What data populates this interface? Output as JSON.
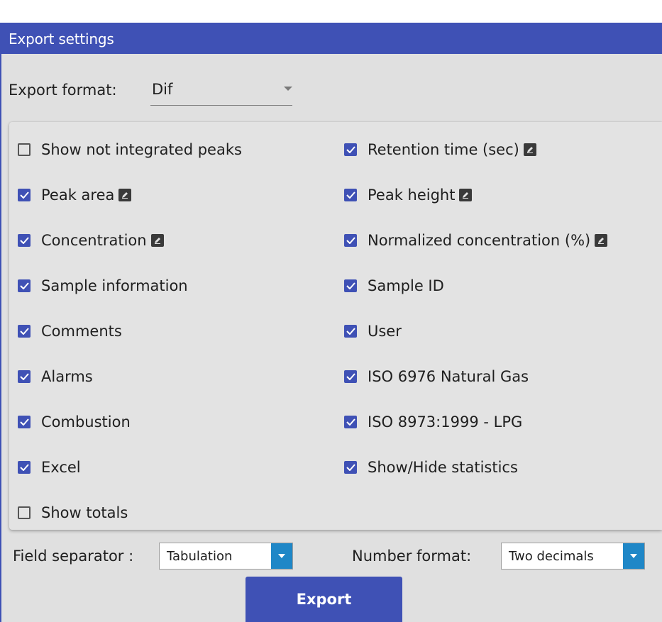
{
  "title": "Export settings",
  "export_format": {
    "label": "Export format:",
    "value": "Dif"
  },
  "options": [
    {
      "label": "Show not integrated peaks",
      "checked": false,
      "editable": false
    },
    {
      "label": "Retention time (sec)",
      "checked": true,
      "editable": true
    },
    {
      "label": "Peak area",
      "checked": true,
      "editable": true
    },
    {
      "label": "Peak height",
      "checked": true,
      "editable": true
    },
    {
      "label": "Concentration",
      "checked": true,
      "editable": true
    },
    {
      "label": "Normalized concentration (%)",
      "checked": true,
      "editable": true
    },
    {
      "label": "Sample information",
      "checked": true,
      "editable": false
    },
    {
      "label": "Sample ID",
      "checked": true,
      "editable": false
    },
    {
      "label": "Comments",
      "checked": true,
      "editable": false
    },
    {
      "label": "User",
      "checked": true,
      "editable": false
    },
    {
      "label": "Alarms",
      "checked": true,
      "editable": false
    },
    {
      "label": "ISO 6976 Natural Gas",
      "checked": true,
      "editable": false
    },
    {
      "label": "Combustion",
      "checked": true,
      "editable": false
    },
    {
      "label": "ISO 8973:1999 - LPG",
      "checked": true,
      "editable": false
    },
    {
      "label": "Excel",
      "checked": true,
      "editable": false
    },
    {
      "label": "Show/Hide statistics",
      "checked": true,
      "editable": false
    },
    {
      "label": "Show totals",
      "checked": false,
      "editable": false
    }
  ],
  "field_separator": {
    "label": "Field separator :",
    "value": "Tabulation"
  },
  "number_format": {
    "label": "Number format:",
    "value": "Two decimals"
  },
  "export_button": "Export",
  "colors": {
    "accent": "#3f51b5",
    "dropdown_button": "#1f87c7",
    "panel": "#e0e0e0"
  }
}
